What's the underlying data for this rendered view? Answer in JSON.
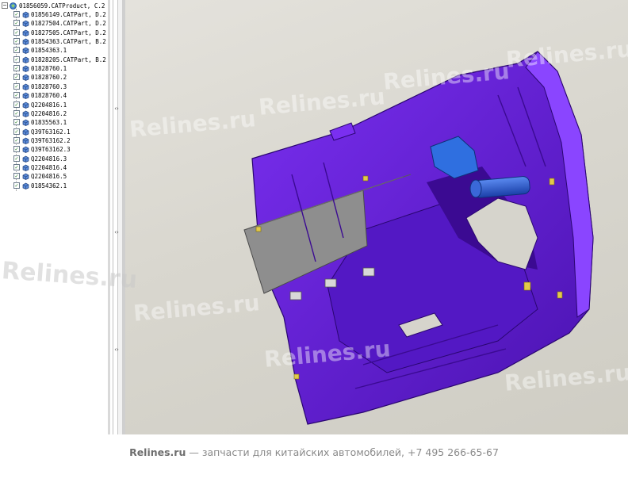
{
  "tree": {
    "root_label": "01856059.CATProduct, C.2",
    "items": [
      {
        "label": "01856149.CATPart, D.2",
        "checked": true
      },
      {
        "label": "01827504.CATPart, D.2",
        "checked": true
      },
      {
        "label": "01827505.CATPart, D.2",
        "checked": true
      },
      {
        "label": "01854363.CATPart, B.2",
        "checked": true
      },
      {
        "label": "01854363.1",
        "checked": true
      },
      {
        "label": "01828205.CATPart, B.2",
        "checked": true
      },
      {
        "label": "01828760.1",
        "checked": true
      },
      {
        "label": "01828760.2",
        "checked": true
      },
      {
        "label": "01828760.3",
        "checked": true
      },
      {
        "label": "01828760.4",
        "checked": true
      },
      {
        "label": "Q2204816.1",
        "checked": true
      },
      {
        "label": "Q2204816.2",
        "checked": true
      },
      {
        "label": "01835563.1",
        "checked": true
      },
      {
        "label": "Q39T63162.1",
        "checked": true
      },
      {
        "label": "Q39T63162.2",
        "checked": true
      },
      {
        "label": "Q39T63162.3",
        "checked": true
      },
      {
        "label": "Q2204816.3",
        "checked": true
      },
      {
        "label": "Q2204816.4",
        "checked": true
      },
      {
        "label": "Q2204816.5",
        "checked": true
      },
      {
        "label": "01854362.1",
        "checked": true
      }
    ]
  },
  "splitter": {
    "arrow_glyph": "‹›"
  },
  "watermark": {
    "text": "Relines.ru"
  },
  "footer": {
    "brand": "Relines.ru",
    "text": " — запчасти для китайских автомобилей, +7 495 266-65-67"
  },
  "colors": {
    "part_purple": "#6a1fd8",
    "part_dark": "#3d0a8f",
    "bracket_blue": "#2f6fe0",
    "check_green": "#1a7a1a"
  },
  "icons": {
    "root": "product-icon",
    "item": "part-icon",
    "check": "checkbox-checked-icon"
  }
}
